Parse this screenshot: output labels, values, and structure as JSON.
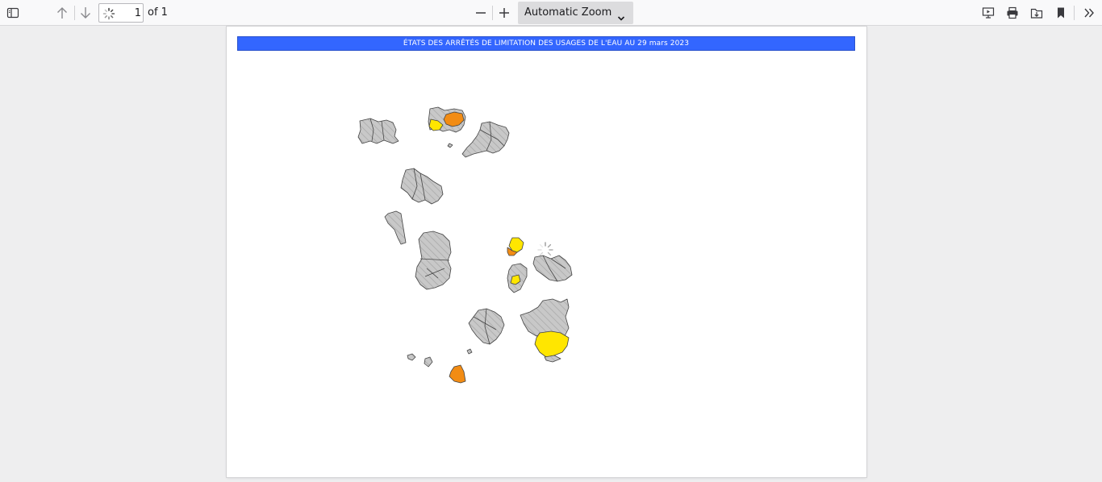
{
  "toolbar": {
    "page_number": "1",
    "page_count": "of 1",
    "zoom": "Automatic Zoom",
    "icons": [
      "sidebar-toggle-icon",
      "previous-page-icon",
      "next-page-icon",
      "zoom-out-icon",
      "zoom-in-icon",
      "presentation-mode-icon",
      "print-icon",
      "open-file-icon",
      "bookmark-icon",
      "tools-menu-icon"
    ]
  },
  "document": {
    "title": "ÉTATS DES ARRÊTÉS DE LIMITATION DES USAGES DE L'EAU AU 29 mars 2023",
    "title_bar_color": "#3366ff",
    "map_colors": {
      "no_restriction": "#c8c8c8",
      "vigilance": "#ffe600",
      "alerte": "#f28c14"
    }
  }
}
